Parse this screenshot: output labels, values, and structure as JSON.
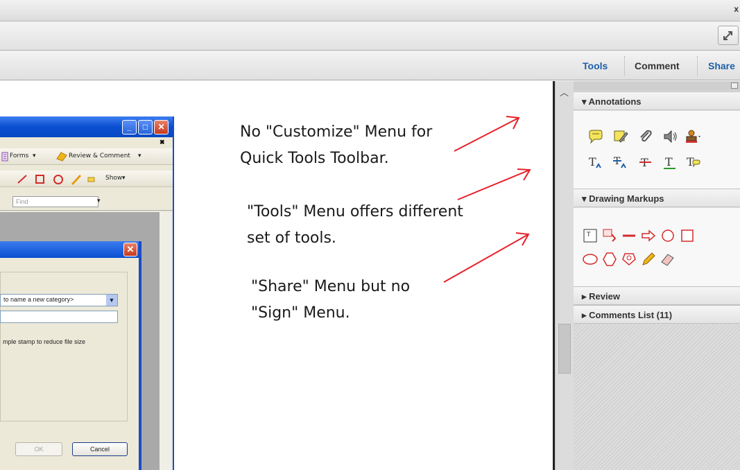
{
  "window": {
    "close_glyph": "x"
  },
  "task_buttons": {
    "tools": "Tools",
    "comment": "Comment",
    "share": "Share"
  },
  "old_window": {
    "menu_forms": "Forms",
    "menu_review": "Review & Comment",
    "show_label": "Show",
    "find_placeholder": "Find",
    "dialog": {
      "category_select": "to name a new category>",
      "checkbox_note": "mple stamp to reduce file size",
      "ok_label": "OK",
      "cancel_label": "Cancel"
    }
  },
  "notes": {
    "note1_line1": "No \"Customize\" Menu for",
    "note1_line2": "Quick Tools Toolbar.",
    "note2_line1": "\"Tools\" Menu offers different",
    "note2_line2": "set of tools.",
    "note3_line1": "\"Share\" Menu but no",
    "note3_line2": "\"Sign\" Menu."
  },
  "arrow_color": "#e8202a",
  "pane": {
    "annotations": "Annotations",
    "drawing_markups": "Drawing Markups",
    "review": "Review",
    "comments_list": "Comments List (11)",
    "expanded_glyph": "▾",
    "collapsed_glyph": "▸"
  }
}
